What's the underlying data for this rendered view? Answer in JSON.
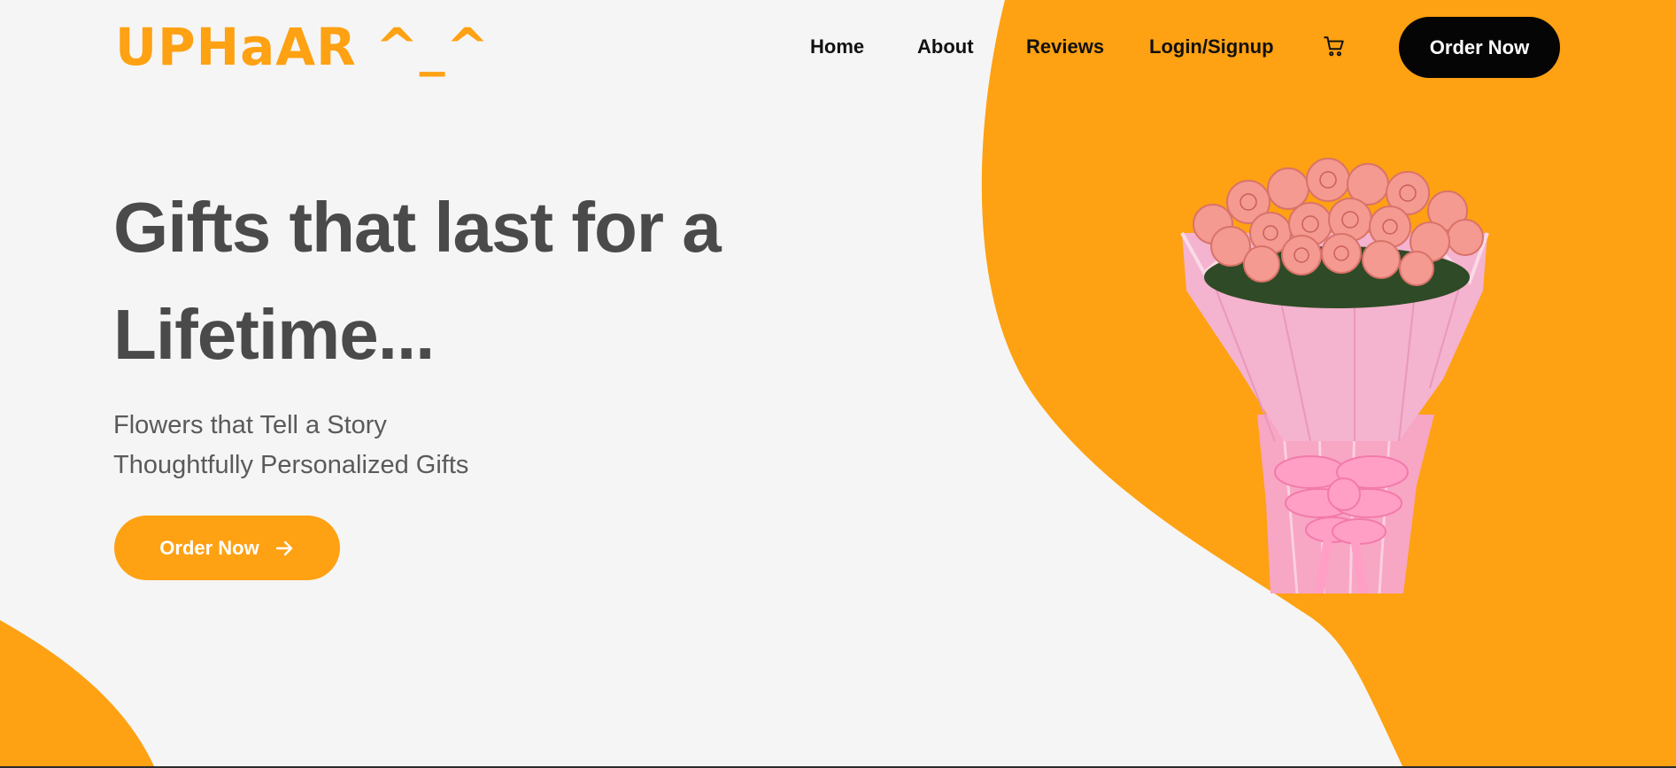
{
  "brand": {
    "logo": "UPHaAR ^_^",
    "accent_color": "#fea112"
  },
  "nav": {
    "links": [
      "Home",
      "About",
      "Reviews",
      "Login/Signup"
    ],
    "cart_icon": "shopping-cart-icon",
    "order_button": "Order Now"
  },
  "hero": {
    "title": "Gifts that last for a Lifetime...",
    "subtitle_1": "Flowers that Tell a Story",
    "subtitle_2": "Thoughtfully Personalized Gifts",
    "cta_label": "Order Now",
    "cta_icon": "arrow-right-icon",
    "image": "pink-rose-bouquet"
  }
}
